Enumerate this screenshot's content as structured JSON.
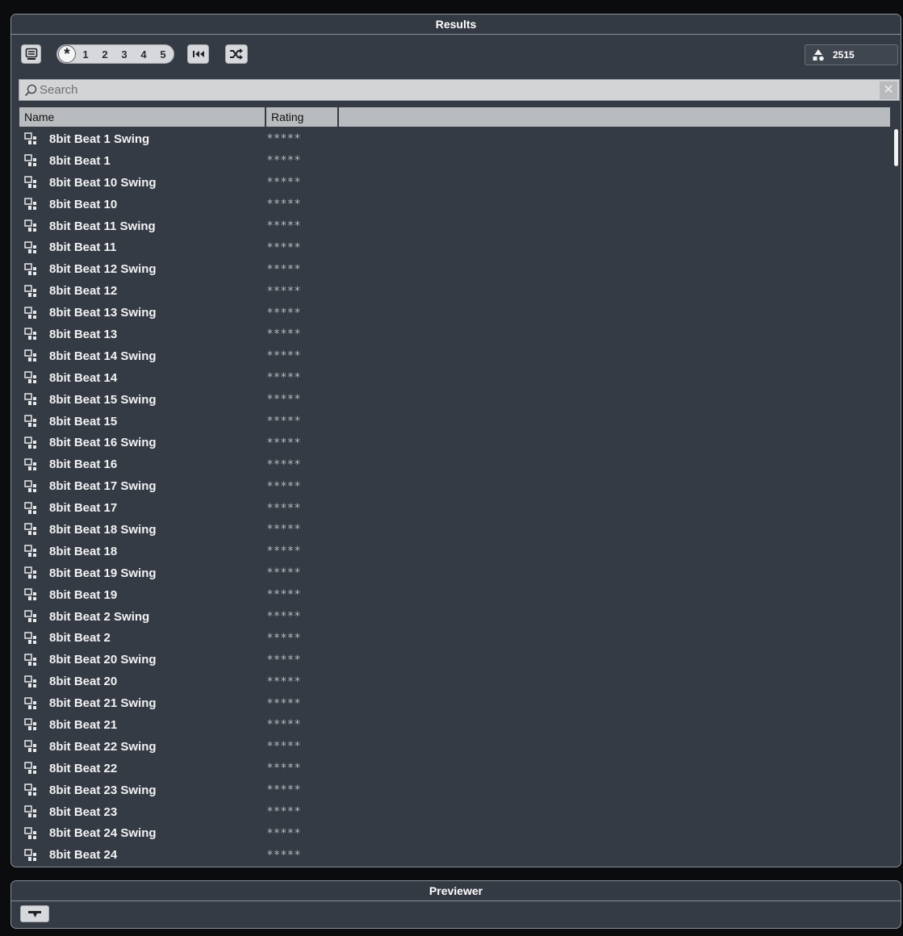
{
  "results": {
    "title": "Results",
    "rating_filter": {
      "any_icon": "asterisk-icon",
      "levels": [
        "1",
        "2",
        "3",
        "4",
        "5"
      ]
    },
    "result_count": "2515",
    "search": {
      "placeholder": "Search",
      "value": ""
    },
    "columns": {
      "name": "Name",
      "rating": "Rating"
    },
    "rows": [
      {
        "name": "8bit Beat 1 Swing",
        "rating": "*****"
      },
      {
        "name": "8bit Beat 1",
        "rating": "*****"
      },
      {
        "name": "8bit Beat 10 Swing",
        "rating": "*****"
      },
      {
        "name": "8bit Beat 10",
        "rating": "*****"
      },
      {
        "name": "8bit Beat 11 Swing",
        "rating": "*****"
      },
      {
        "name": "8bit Beat 11",
        "rating": "*****"
      },
      {
        "name": "8bit Beat 12 Swing",
        "rating": "*****"
      },
      {
        "name": "8bit Beat 12",
        "rating": "*****"
      },
      {
        "name": "8bit Beat 13 Swing",
        "rating": "*****"
      },
      {
        "name": "8bit Beat 13",
        "rating": "*****"
      },
      {
        "name": "8bit Beat 14 Swing",
        "rating": "*****"
      },
      {
        "name": "8bit Beat 14",
        "rating": "*****"
      },
      {
        "name": "8bit Beat 15 Swing",
        "rating": "*****"
      },
      {
        "name": "8bit Beat 15",
        "rating": "*****"
      },
      {
        "name": "8bit Beat 16 Swing",
        "rating": "*****"
      },
      {
        "name": "8bit Beat 16",
        "rating": "*****"
      },
      {
        "name": "8bit Beat 17 Swing",
        "rating": "*****"
      },
      {
        "name": "8bit Beat 17",
        "rating": "*****"
      },
      {
        "name": "8bit Beat 18 Swing",
        "rating": "*****"
      },
      {
        "name": "8bit Beat 18",
        "rating": "*****"
      },
      {
        "name": "8bit Beat 19 Swing",
        "rating": "*****"
      },
      {
        "name": "8bit Beat 19",
        "rating": "*****"
      },
      {
        "name": "8bit Beat 2 Swing",
        "rating": "*****"
      },
      {
        "name": "8bit Beat 2",
        "rating": "*****"
      },
      {
        "name": "8bit Beat 20 Swing",
        "rating": "*****"
      },
      {
        "name": "8bit Beat 20",
        "rating": "*****"
      },
      {
        "name": "8bit Beat 21 Swing",
        "rating": "*****"
      },
      {
        "name": "8bit Beat 21",
        "rating": "*****"
      },
      {
        "name": "8bit Beat 22 Swing",
        "rating": "*****"
      },
      {
        "name": "8bit Beat 22",
        "rating": "*****"
      },
      {
        "name": "8bit Beat 23 Swing",
        "rating": "*****"
      },
      {
        "name": "8bit Beat 23",
        "rating": "*****"
      },
      {
        "name": "8bit Beat 24 Swing",
        "rating": "*****"
      },
      {
        "name": "8bit Beat 24",
        "rating": "*****"
      }
    ]
  },
  "previewer": {
    "title": "Previewer"
  },
  "icons": {
    "view": "monitor-icon",
    "rewind": "rewind-to-start-icon",
    "shuffle": "shuffle-icon",
    "count": "shapes-icon",
    "search": "search-icon",
    "clear": "close-icon",
    "row": "pattern-preset-icon",
    "previewer": "previewer-toggle-icon"
  }
}
